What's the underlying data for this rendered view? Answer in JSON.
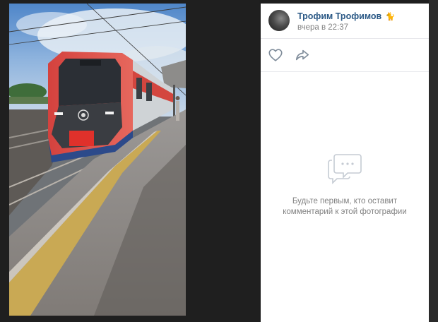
{
  "post": {
    "author_name": "Трофим Трофимов",
    "author_emoji": "🐈",
    "time": "вчера в 22:37"
  },
  "actions": {
    "like_icon": "heart-icon",
    "share_icon": "share-arrow-icon"
  },
  "comments": {
    "empty_icon": "comment-bubble-icon",
    "empty_line1": "Будьте первым, кто оставит",
    "empty_line2": "комментарий к этой фотографии"
  },
  "colors": {
    "author_link": "#2a5885",
    "secondary_text": "#828282",
    "backdrop": "#1e1e1e"
  }
}
